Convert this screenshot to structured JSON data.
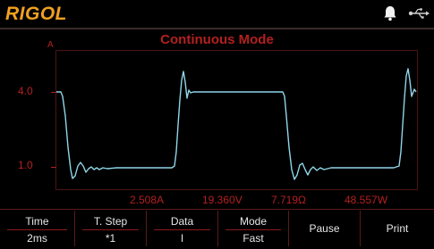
{
  "header": {
    "brand": "RIGOL",
    "icons": [
      "bell-icon",
      "usb-icon"
    ]
  },
  "plot": {
    "title": "Continuous Mode",
    "y_unit": "A",
    "y_ticks": [
      "4.0",
      "1.0"
    ],
    "readouts": [
      "2.508A",
      "19.360V",
      "7.719Ω",
      "48.557W"
    ]
  },
  "softkeys": [
    {
      "title": "Time",
      "value": "2ms"
    },
    {
      "title": "T. Step",
      "value": "*1"
    },
    {
      "title": "Data",
      "value": "I"
    },
    {
      "title": "Mode",
      "value": "Fast"
    },
    {
      "title": "Pause",
      "value": ""
    },
    {
      "title": "Print",
      "value": ""
    }
  ],
  "colors": {
    "accent_red": "#b32020",
    "trace": "#8fd6e8",
    "brand": "#f0a020"
  }
}
